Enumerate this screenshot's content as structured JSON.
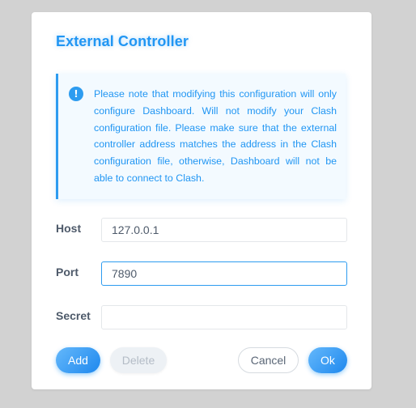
{
  "dialog": {
    "title": "External Controller",
    "notice": {
      "icon": "info-icon",
      "icon_glyph": "!",
      "text": "Please note that modifying this configuration will only configure Dashboard. Will not modify your Clash configuration file. Please make sure that the external controller address matches the address in the Clash configuration file, otherwise, Dashboard will not be able to connect to Clash."
    },
    "fields": {
      "host": {
        "label": "Host",
        "value": "127.0.0.1"
      },
      "port": {
        "label": "Port",
        "value": "7890"
      },
      "secret": {
        "label": "Secret",
        "value": ""
      }
    },
    "buttons": {
      "add": "Add",
      "delete": "Delete",
      "cancel": "Cancel",
      "ok": "Ok"
    }
  },
  "colors": {
    "accent": "#2196f3",
    "background": "#d2d2d2",
    "notice_background": "#f3faff",
    "label": "#4e5a6a"
  }
}
